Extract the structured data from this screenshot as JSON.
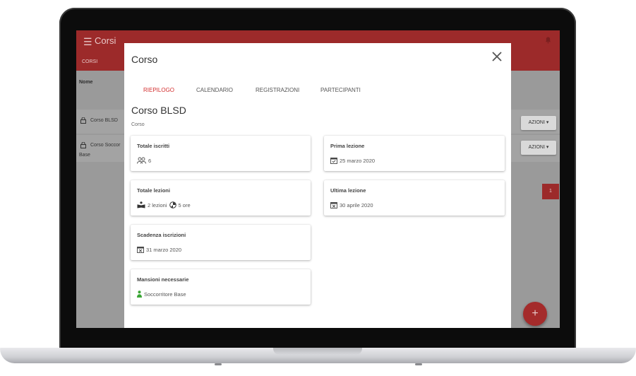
{
  "app": {
    "title": "Corsi",
    "header_tab": "CORSI",
    "column_header": "Nome",
    "rows": [
      {
        "name": "Corso BLSD",
        "action": "AZIONI ▾"
      },
      {
        "name": "Corso Soccor",
        "name_line2": "Base",
        "action": "AZIONI ▾"
      }
    ],
    "page_number": "1",
    "fab_label": "+"
  },
  "modal": {
    "title": "Corso",
    "tabs": [
      {
        "label": "RIEPILOGO",
        "active": true
      },
      {
        "label": "CALENDARIO",
        "active": false
      },
      {
        "label": "REGISTRAZIONI",
        "active": false
      },
      {
        "label": "PARTECIPANTI",
        "active": false
      }
    ],
    "course_name": "Corso BLSD",
    "course_subtitle": "Corso",
    "cards": {
      "totale_iscritti": {
        "title": "Totale iscritti",
        "value": "6",
        "icon": "people-icon"
      },
      "prima_lezione": {
        "title": "Prima lezione",
        "value": "25 marzo 2020",
        "icon": "calendar-check-icon"
      },
      "totale_lezioni": {
        "title": "Totale lezioni",
        "value_lessons": "2 lezioni",
        "value_hours": "5 ore",
        "icon": "book-reader-icon"
      },
      "ultima_lezione": {
        "title": "Ultima lezione",
        "value": "30 aprile 2020",
        "icon": "calendar-x-icon"
      },
      "scadenza_iscrizioni": {
        "title": "Scadenza iscrizioni",
        "value": "31 marzo 2020",
        "icon": "calendar-x-icon"
      },
      "mansioni_necessarie": {
        "title": "Mansioni necessarie",
        "value": "Soccorritore Base",
        "icon": "person-icon"
      }
    }
  },
  "colors": {
    "header": "#9c2a2a",
    "accent": "#d32f2f",
    "role_green": "#3aa635"
  }
}
